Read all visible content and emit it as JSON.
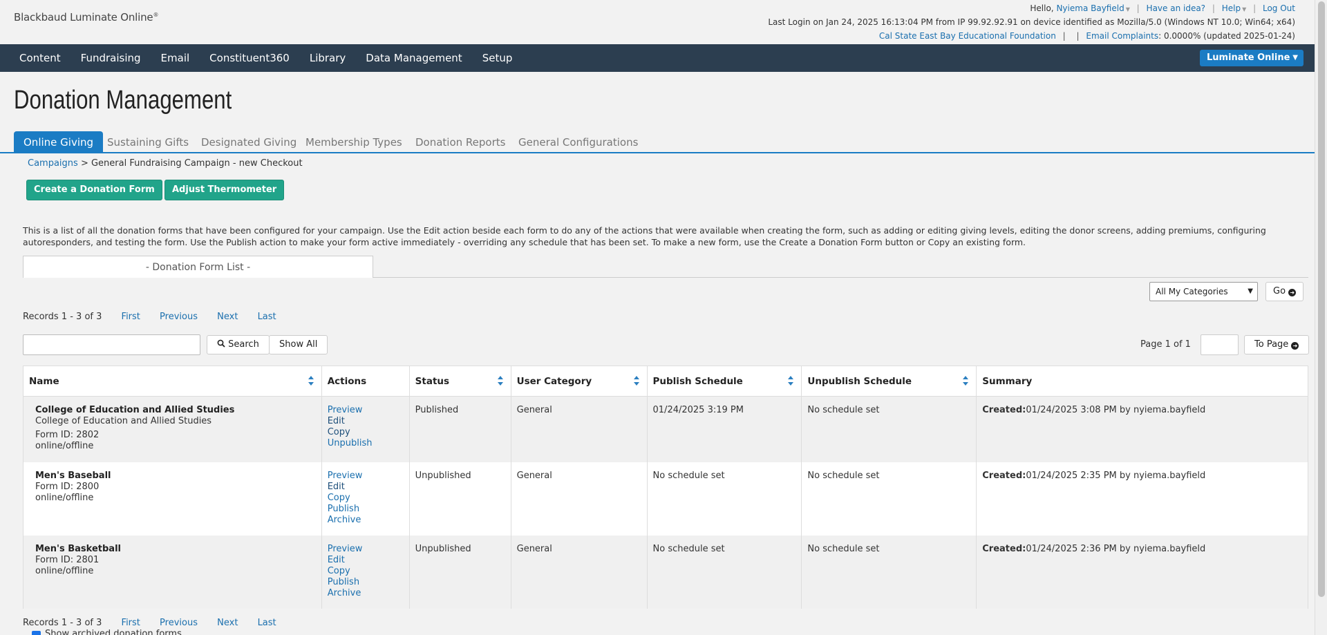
{
  "header": {
    "brand": "Blackbaud Luminate Online",
    "brand_mark": "®",
    "greeting": "Hello,",
    "user_name": "Nyiema Bayfield",
    "have_idea": "Have an idea?",
    "help": "Help",
    "logout": "Log Out",
    "last_login": "Last Login on Jan 24, 2025 16:13:04 PM from IP 99.92.92.91 on device identified as Mozilla/5.0 (Windows NT 10.0; Win64; x64)",
    "org_name": "Cal State East Bay Educational Foundation",
    "email_complaints_label": "Email Complaints",
    "email_complaints_value": ": 0.0000% (updated 2025-01-24)"
  },
  "nav": {
    "items": [
      "Content",
      "Fundraising",
      "Email",
      "Constituent360",
      "Library",
      "Data Management",
      "Setup"
    ],
    "product_button": "Luminate Online"
  },
  "page": {
    "title": "Donation Management",
    "tabs": [
      "Online Giving",
      "Sustaining Gifts",
      "Designated Giving",
      "Membership Types",
      "Donation Reports",
      "General Configurations"
    ],
    "active_tab": "Online Giving",
    "breadcrumb_link": "Campaigns",
    "breadcrumb_rest": " > General Fundraising Campaign - new Checkout",
    "create_button": "Create a Donation Form",
    "adjust_button": "Adjust Thermometer",
    "description": "This is a list of all the donation forms that have been configured for your campaign. Use the Edit action beside each form to do any of the actions that were available when creating the form, such as adding or editing giving levels, editing the donor screens, adding premiums, configuring autoresponders, and testing the form. Use the Publish action to make your form active immediately - overriding any schedule that has been set. To make a new form, use the Create a Donation Form button or Copy an existing form.",
    "subtab": "- Donation Form List -",
    "category_select": "All My Categories",
    "go_button": "Go",
    "records_text": "Records 1 - 3 of 3",
    "pager": {
      "first": "First",
      "previous": "Previous",
      "next": "Next",
      "last": "Last"
    },
    "search_button": "Search",
    "show_all_button": "Show All",
    "page_of": "Page 1 of 1",
    "to_page_button": "To Page",
    "show_archived": "Show archived donation forms"
  },
  "table": {
    "columns": [
      "Name",
      "Actions",
      "Status",
      "User Category",
      "Publish Schedule",
      "Unpublish Schedule",
      "Summary"
    ],
    "rows": [
      {
        "name": "College of Education and Allied Studies",
        "subtitle": "College of Education and Allied Studies",
        "form_id": "Form ID: 2802",
        "mode": "online/offline",
        "actions": [
          "Preview",
          "Edit",
          "Copy",
          "Unpublish"
        ],
        "status": "Published",
        "category": "General",
        "publish": "01/24/2025 3:19 PM",
        "unpublish": "No schedule set",
        "created_label": "Created:",
        "created_value": "01/24/2025 3:08 PM by nyiema.bayfield"
      },
      {
        "name": "Men's Baseball",
        "subtitle": "",
        "form_id": "Form ID: 2800",
        "mode": "online/offline",
        "actions": [
          "Preview",
          "Edit",
          "Copy",
          "Publish",
          "Archive"
        ],
        "status": "Unpublished",
        "category": "General",
        "publish": "No schedule set",
        "unpublish": "No schedule set",
        "created_label": "Created:",
        "created_value": "01/24/2025 2:35 PM by nyiema.bayfield"
      },
      {
        "name": "Men's Basketball",
        "subtitle": "",
        "form_id": "Form ID: 2801",
        "mode": "online/offline",
        "actions": [
          "Preview",
          "Edit",
          "Copy",
          "Publish",
          "Archive"
        ],
        "status": "Unpublished",
        "category": "General",
        "publish": "No schedule set",
        "unpublish": "No schedule set",
        "created_label": "Created:",
        "created_value": "01/24/2025 2:36 PM by nyiema.bayfield"
      }
    ]
  },
  "colors": {
    "navbar": "#2c3e50",
    "accent_blue": "#1b7cc4",
    "green_button": "#21a48a",
    "link": "#1a6fae"
  }
}
